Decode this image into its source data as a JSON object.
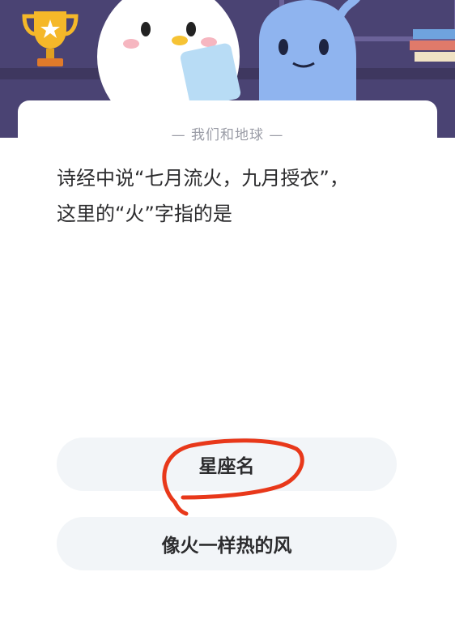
{
  "quiz": {
    "category": "— 我们和地球 —",
    "question_line1": "诗经中说“七月流火，九月授衣”，",
    "question_line2": "这里的“火”字指的是",
    "options": [
      {
        "label": "星座名",
        "annotated": true
      },
      {
        "label": "像火一样热的风",
        "annotated": false
      }
    ]
  },
  "colors": {
    "banner_bg": "#4a4373",
    "option_bg": "#f2f5f8",
    "annotation": "#e8381a"
  },
  "icons": [
    "trophy-icon",
    "penguin-mascot-icon",
    "blue-mascot-icon",
    "books-icon"
  ]
}
